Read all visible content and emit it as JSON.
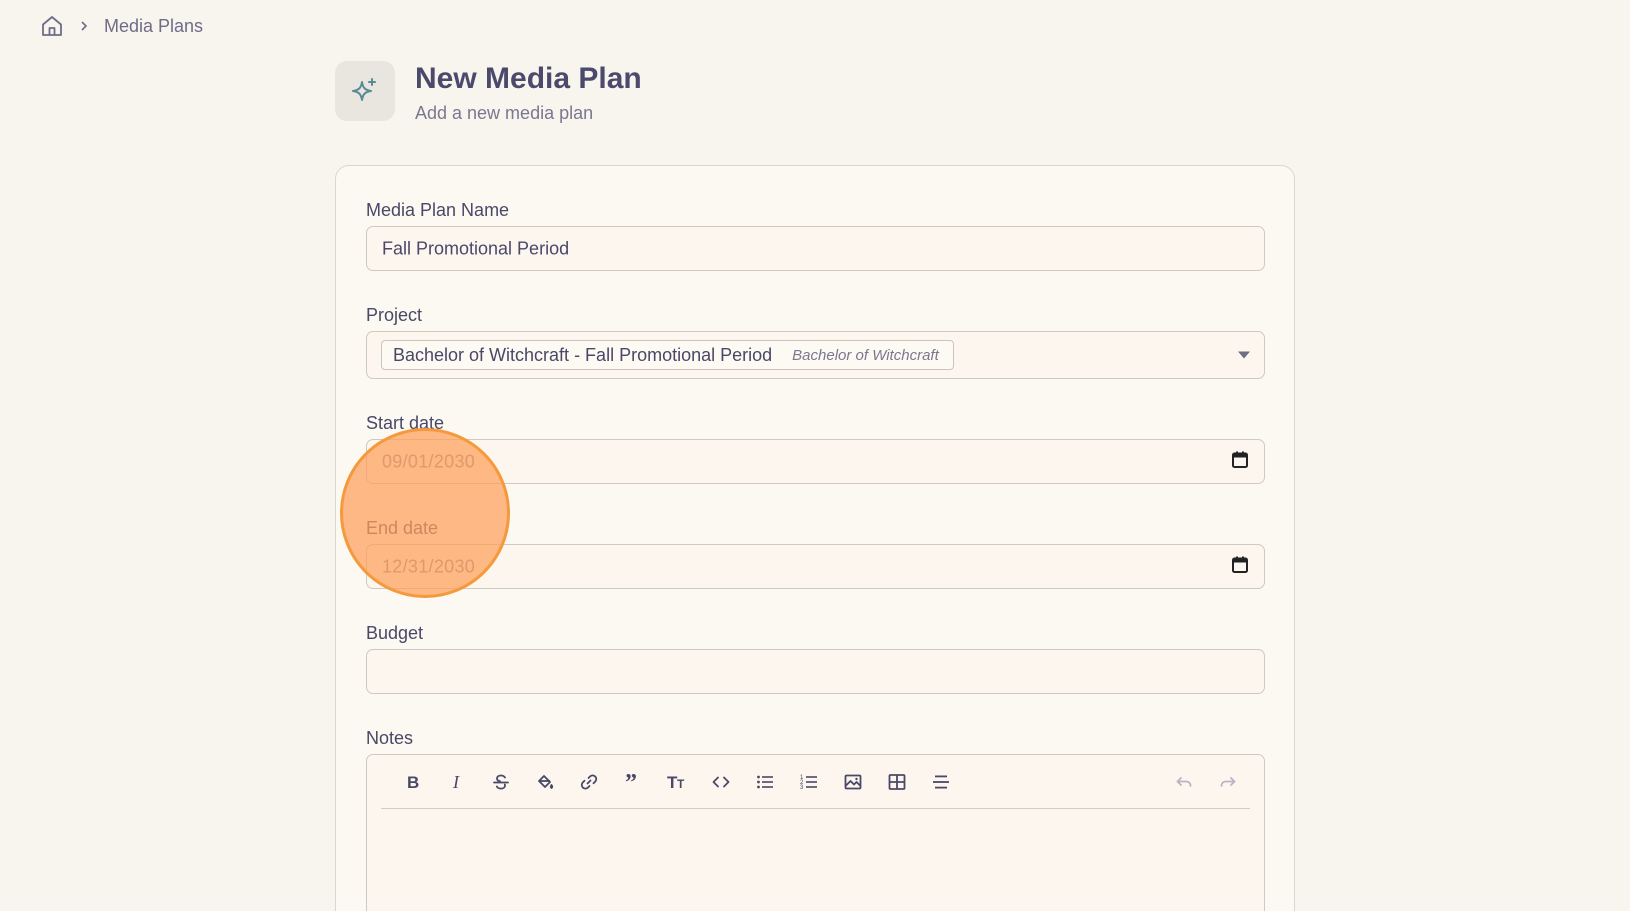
{
  "breadcrumb": {
    "home_icon": "home-icon",
    "separator_icon": "chevron-right-icon",
    "current": "Media Plans"
  },
  "header": {
    "icon": "sparkles-icon",
    "title": "New Media Plan",
    "subtitle": "Add a new media plan"
  },
  "form": {
    "name": {
      "label": "Media Plan Name",
      "value": "Fall Promotional Period"
    },
    "project": {
      "label": "Project",
      "value": "Bachelor of Witchcraft - Fall Promotional Period",
      "secondary": "Bachelor of Witchcraft"
    },
    "start_date": {
      "label": "Start date",
      "value": "09/01/2030"
    },
    "end_date": {
      "label": "End date",
      "value": "12/31/2030"
    },
    "budget": {
      "label": "Budget",
      "value": ""
    },
    "notes": {
      "label": "Notes",
      "toolbar": [
        "bold-icon",
        "italic-icon",
        "strikethrough-icon",
        "paint-bucket-icon",
        "link-icon",
        "quote-icon",
        "text-size-icon",
        "code-icon",
        "bullet-list-icon",
        "numbered-list-icon",
        "image-icon",
        "table-icon",
        "horizontal-rule-icon",
        "undo-icon",
        "redo-icon"
      ],
      "value": ""
    }
  },
  "colors": {
    "background": "#f8f4ee",
    "text": "#4a4868",
    "accent_icon": "#5a8a95",
    "click_highlight": "#f59a3c"
  }
}
